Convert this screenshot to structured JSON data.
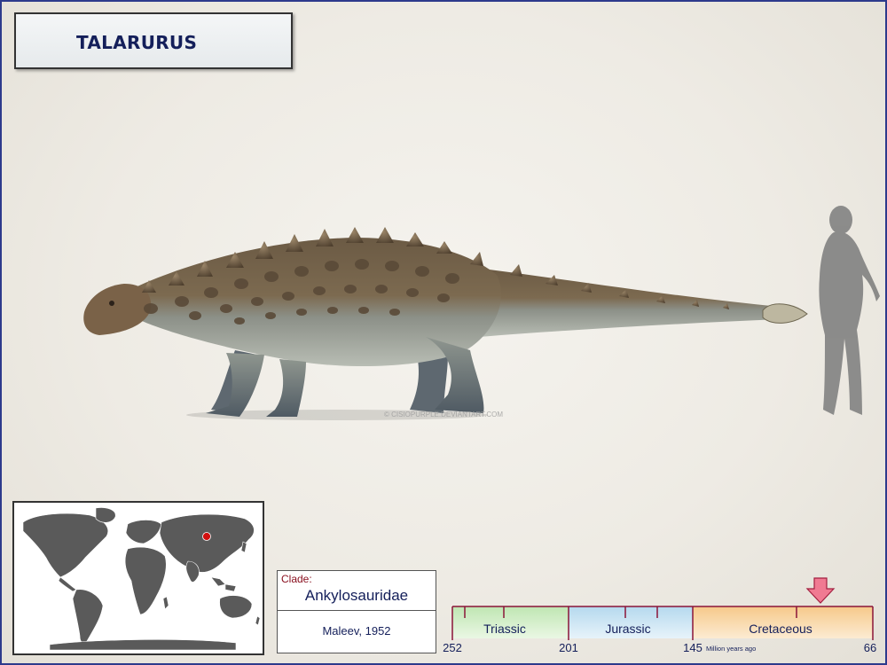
{
  "title": "TALARURUS",
  "watermark": "© CISIOPURPLE.DEVIANTART.COM",
  "clade": {
    "label": "Clade:",
    "name": "Ankylosauridae",
    "author": "Maleev, 1952"
  },
  "timeline": {
    "periods": [
      {
        "name": "Triassic",
        "color": "#bfe6b2"
      },
      {
        "name": "Jurassic",
        "color": "#b5d9ee"
      },
      {
        "name": "Cretaceous",
        "color": "#f6c98a"
      }
    ],
    "ticks": [
      "252",
      "201",
      "145",
      "66"
    ],
    "unit": "Million years ago"
  },
  "colors": {
    "border": "#2d3a8c",
    "title_text": "#141f5a",
    "timeline_line": "#8a1438",
    "arrow": "#f07a92",
    "locator_dot": "#d10f0f"
  },
  "icons": {
    "locator": "red-dot-icon",
    "arrow": "down-arrow-icon"
  }
}
